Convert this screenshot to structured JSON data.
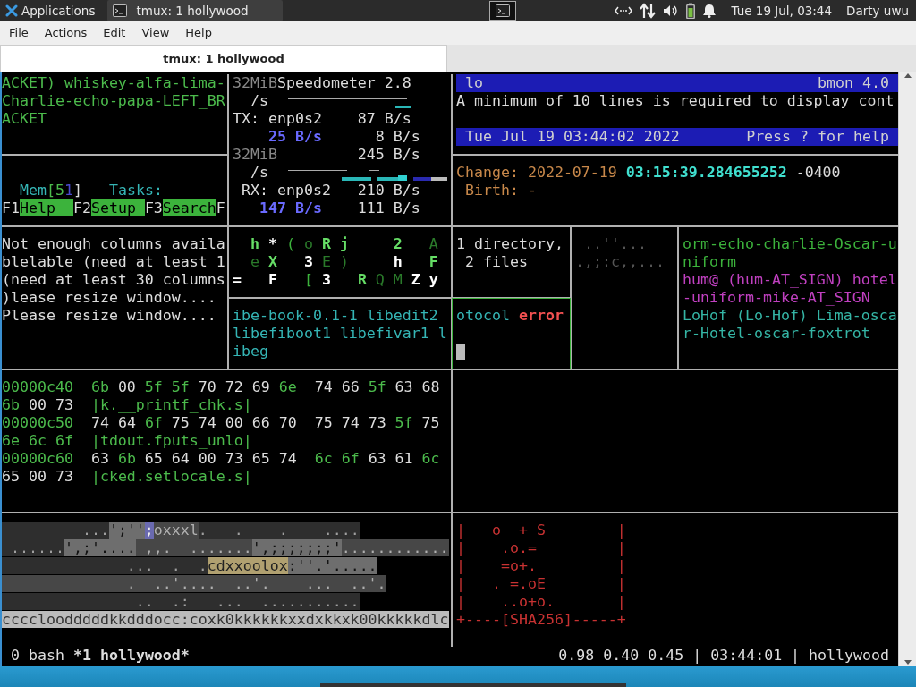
{
  "panel": {
    "apps_label": "Applications",
    "tasks": [
      {
        "title": "tmux: 1 hollywood",
        "selected": true
      }
    ],
    "clock": "Tue 19 Jul, 03:44",
    "user": "Darty uwu"
  },
  "menu": [
    "File",
    "Actions",
    "Edit",
    "View",
    "Help"
  ],
  "tabs": [
    {
      "label": "tmux: 1 hollywood",
      "selected": true
    }
  ],
  "panes": [
    {
      "kind": "text",
      "active": false,
      "color": "#4cbb4c",
      "lines": [
        [
          {
            "text": "ACKET) whiskey-alfa-lima-"
          }
        ],
        [
          {
            "text": "Charlie-echo-papa-LEFT_BR"
          }
        ],
        [
          {
            "text": "ACKET"
          }
        ]
      ]
    },
    {
      "kind": "text",
      "active": false,
      "color": "#dddddd",
      "lines": [
        {
          "kind": "blank"
        },
        [
          {
            "text": "  Mem",
            "color": "#35b5b5"
          },
          {
            "text": "[",
            "color": "#4cbb4c"
          },
          {
            "text": "5",
            "color": "#4cbb4c"
          },
          {
            "text": "1",
            "color": "#4a4ad0"
          },
          {
            "text": "]",
            "color": "#dddddd"
          },
          {
            "text": "   Tasks:",
            "color": "#35b5b5"
          }
        ],
        [
          {
            "text": "F1"
          },
          {
            "text": "Help  ",
            "kind": "key"
          },
          {
            "text": "F2"
          },
          {
            "text": "Setup ",
            "kind": "key"
          },
          {
            "text": "F3"
          },
          {
            "text": "Search",
            "kind": "key"
          },
          {
            "text": "F"
          }
        ]
      ]
    },
    {
      "kind": "graph",
      "active": false,
      "color": "#dddddd",
      "lines": [
        [
          {
            "text": "32MiB",
            "color": "#888888"
          },
          {
            "text": "Speedometer 2.8"
          }
        ],
        [
          {
            "text": "  /s"
          }
        ],
        [
          {
            "text": "TX: enp0s2    87 B/s"
          }
        ],
        [
          {
            "text": "    25 B/s",
            "color": "#6a6aff",
            "bold": true
          },
          {
            "text": "      8 B/s"
          }
        ],
        [
          {
            "text": "32MiB",
            "color": "#888888"
          },
          {
            "text": "         245 B/s"
          }
        ],
        [
          {
            "text": "  /s"
          }
        ],
        [
          {
            "text": " RX: enp0s2   210 B/s"
          }
        ],
        [
          {
            "text": "   147 B/s",
            "color": "#6a6aff",
            "bold": true
          },
          {
            "text": "    111 B/s"
          }
        ]
      ]
    },
    {
      "kind": "text",
      "active": false,
      "color": "#dddddd",
      "lines": [
        {
          "kind": "bar",
          "left": "lo",
          "right": "bmon 4.0"
        },
        [
          {
            "text": "A minimum of 10 lines is required to display cont"
          }
        ],
        {
          "kind": "blank"
        },
        {
          "kind": "bar",
          "left": "Tue Jul 19 03:44:02 2022",
          "right": "Press ? for help"
        }
      ]
    },
    {
      "kind": "text",
      "active": false,
      "color": "#c8884a",
      "lines": [
        [
          {
            "text": "Change: 2022-07-19 "
          },
          {
            "text": "03:15:39.284655252",
            "color": "#40e0d0",
            "bold": true
          },
          {
            "text": " -0400",
            "color": "#dddddd"
          }
        ],
        [
          {
            "text": " Birth: -"
          }
        ]
      ]
    },
    {
      "kind": "text",
      "active": false,
      "color": "#dddddd",
      "lines": [
        [
          {
            "text": "Not enough columns availa"
          }
        ],
        [
          {
            "text": "blelable (need at least 1"
          }
        ],
        [
          {
            "text": "(need at least 30 columns"
          }
        ],
        [
          {
            "text": ")lease resize window...."
          }
        ],
        [
          {
            "text": "Please resize window...."
          }
        ]
      ]
    },
    {
      "kind": "text",
      "active": false,
      "color": "#3cb33c",
      "lines": [
        [
          {
            "text": "  h",
            "color": "#66dd66",
            "bold": true
          },
          {
            "text": " *",
            "color": "#ffffff",
            "bold": true
          },
          {
            "text": " (",
            "color": "#3cb33c"
          },
          {
            "text": " o",
            "color": "#2a7a2a"
          },
          {
            "text": " R",
            "color": "#66dd66",
            "bold": true
          },
          {
            "text": " j",
            "color": "#66dd66",
            "bold": true
          },
          {
            "text": "     2",
            "color": "#66dd66",
            "bold": true
          },
          {
            "text": "   A",
            "color": "#2a7a2a"
          }
        ],
        [
          {
            "text": "  e",
            "color": "#2a7a2a"
          },
          {
            "text": " X",
            "color": "#66dd66",
            "bold": true
          },
          {
            "text": "   3",
            "color": "#ffffff",
            "bold": true
          },
          {
            "text": " E )",
            "color": "#2a7a2a"
          },
          {
            "text": "     h",
            "color": "#ffffff",
            "bold": true
          },
          {
            "text": "   F",
            "color": "#66dd66",
            "bold": true
          }
        ],
        [
          {
            "text": "=   F",
            "color": "#ffffff",
            "bold": true
          },
          {
            "text": "   [",
            "color": "#3cb33c"
          },
          {
            "text": " 3",
            "color": "#ffffff",
            "bold": true
          },
          {
            "text": "   R",
            "color": "#66dd66",
            "bold": true
          },
          {
            "text": " Q M",
            "color": "#2a7a2a"
          },
          {
            "text": " Z y",
            "color": "#ffffff",
            "bold": true
          }
        ]
      ]
    },
    {
      "kind": "text",
      "active": false,
      "color": "#35b5b5",
      "lines": [
        [
          {
            "text": "ibe-book-0.1-1 libedit2"
          }
        ],
        [
          {
            "text": "libefiboot1 libefivar1 l"
          }
        ],
        [
          {
            "text": "ibeg"
          }
        ]
      ]
    },
    {
      "kind": "text",
      "active": false,
      "color": "#dddddd",
      "lines": [
        [
          {
            "text": "1 directory,"
          }
        ],
        [
          {
            "text": " 2 files"
          }
        ]
      ]
    },
    {
      "kind": "text",
      "active": true,
      "color": "#35b5b5",
      "lines": [
        [
          {
            "text": "otocol "
          },
          {
            "text": "error",
            "color": "#f05050",
            "bold": true
          }
        ],
        {
          "kind": "blank"
        },
        {
          "kind": "cursor"
        }
      ]
    },
    {
      "kind": "text",
      "active": false,
      "color": "#555555",
      "lines": [
        [
          {
            "text": " ..''..."
          }
        ],
        [
          {
            "text": ".,;:c,,..."
          }
        ]
      ]
    },
    {
      "kind": "text",
      "active": false,
      "color": "#3cb33c",
      "lines": [
        [
          {
            "text": "orm-echo-charlie-Oscar-u"
          }
        ],
        [
          {
            "text": "niform"
          }
        ],
        [
          {
            "text": "hum@ (hum-AT_SIGN) hotel",
            "color": "#c040c0"
          }
        ],
        [
          {
            "text": "-uniform-mike-AT_SIGN",
            "color": "#c040c0"
          }
        ],
        [
          {
            "text": "LoHof (Lo-Hof) Lima-osca",
            "color": "#35b5a5"
          }
        ],
        [
          {
            "text": "r-Hotel-oscar-foxtrot",
            "color": "#35b5a5"
          }
        ]
      ]
    },
    {
      "kind": "text",
      "active": false,
      "color": "#dddddd",
      "lines": [
        [
          {
            "text": "00000c40  6b",
            "color": "#4cbb4c"
          },
          {
            "text": " 00 "
          },
          {
            "text": "5f 5f",
            "color": "#4cbb4c"
          },
          {
            "text": " 70 72 69 "
          },
          {
            "text": "6e",
            "color": "#4cbb4c"
          },
          {
            "text": "  74 66 "
          },
          {
            "text": "5f",
            "color": "#4cbb4c"
          },
          {
            "text": " 63 68"
          }
        ],
        [
          {
            "text": "6b",
            "color": "#4cbb4c"
          },
          {
            "text": " 00 73  "
          },
          {
            "text": "|k.__printf_chk.s|",
            "color": "#4cbb4c"
          }
        ],
        [
          {
            "text": "00000c50",
            "color": "#4cbb4c"
          },
          {
            "text": "  74 64 "
          },
          {
            "text": "6f",
            "color": "#4cbb4c"
          },
          {
            "text": " 75 74 00 66 70  75 74 73 "
          },
          {
            "text": "5f",
            "color": "#4cbb4c"
          },
          {
            "text": " 75"
          }
        ],
        [
          {
            "text": "6e 6c 6f  |tdout.fputs_unlo|",
            "color": "#4cbb4c"
          }
        ],
        [
          {
            "text": "00000c60",
            "color": "#4cbb4c"
          },
          {
            "text": "  63 "
          },
          {
            "text": "6b",
            "color": "#4cbb4c"
          },
          {
            "text": " 65 64 00 73 65 74  "
          },
          {
            "text": "6c 6f",
            "color": "#4cbb4c"
          },
          {
            "text": " 63 61 "
          },
          {
            "text": "6c",
            "color": "#4cbb4c"
          }
        ],
        [
          {
            "text": "65 00 73  "
          },
          {
            "text": "|cked.setlocale.s|",
            "color": "#4cbb4c"
          }
        ]
      ]
    },
    {
      "kind": "text",
      "active": false,
      "color": "#a0a0a0",
      "lines": [
        [
          {
            "text": "         ...",
            "kind": "dim"
          },
          {
            "text": "';''",
            "kind": "bright"
          },
          {
            "text": ";",
            "kind": "accent"
          },
          {
            "text": "oxxxl",
            "kind": "mid"
          },
          {
            "text": ".   .    .    ....",
            "kind": "dim"
          }
        ],
        [
          {
            "text": " ......",
            "kind": "dim"
          },
          {
            "text": "',;'....",
            "kind": "bright"
          },
          {
            "text": " ,,.  .......",
            "kind": "mid"
          },
          {
            "text": "',;;;;;;;'",
            "kind": "bright"
          },
          {
            "text": "............",
            "kind": "mid"
          }
        ],
        [
          {
            "text": "              ...  .  .",
            "kind": "dim"
          },
          {
            "text": "cdxxoolox",
            "kind": "warm"
          },
          {
            "text": ":''.'.....",
            "kind": "bright"
          }
        ],
        [
          {
            "text": "              .  ..'....  ..'.    ...  ..'.",
            "kind": "mid"
          }
        ],
        [
          {
            "text": "               ..  .:   ...  ...........",
            "kind": "dim"
          }
        ],
        [
          {
            "text": "ccccloodddddkkdddocc:coxk0kkkkkkxxdxkkxk00kkkkkdlc",
            "kind": "light"
          }
        ]
      ]
    },
    {
      "kind": "text",
      "active": false,
      "color": "#c83232",
      "lines": [
        [
          {
            "text": "|   o  + S        |"
          }
        ],
        [
          {
            "text": "|    .o.=         |"
          }
        ],
        [
          {
            "text": "|    =o+.         |"
          }
        ],
        [
          {
            "text": "|   . =.oE        |"
          }
        ],
        [
          {
            "text": "|    ..o+o.       |"
          }
        ],
        [
          {
            "text": "+----[SHA256]-----+"
          }
        ]
      ]
    }
  ],
  "status_bar": {
    "windows": [
      {
        "label": "0 bash",
        "selected": false
      },
      {
        "label": "*1 hollywood*",
        "selected": true
      }
    ],
    "info": "0.98 0.40 0.45 | 03:44:01 | hollywood"
  }
}
